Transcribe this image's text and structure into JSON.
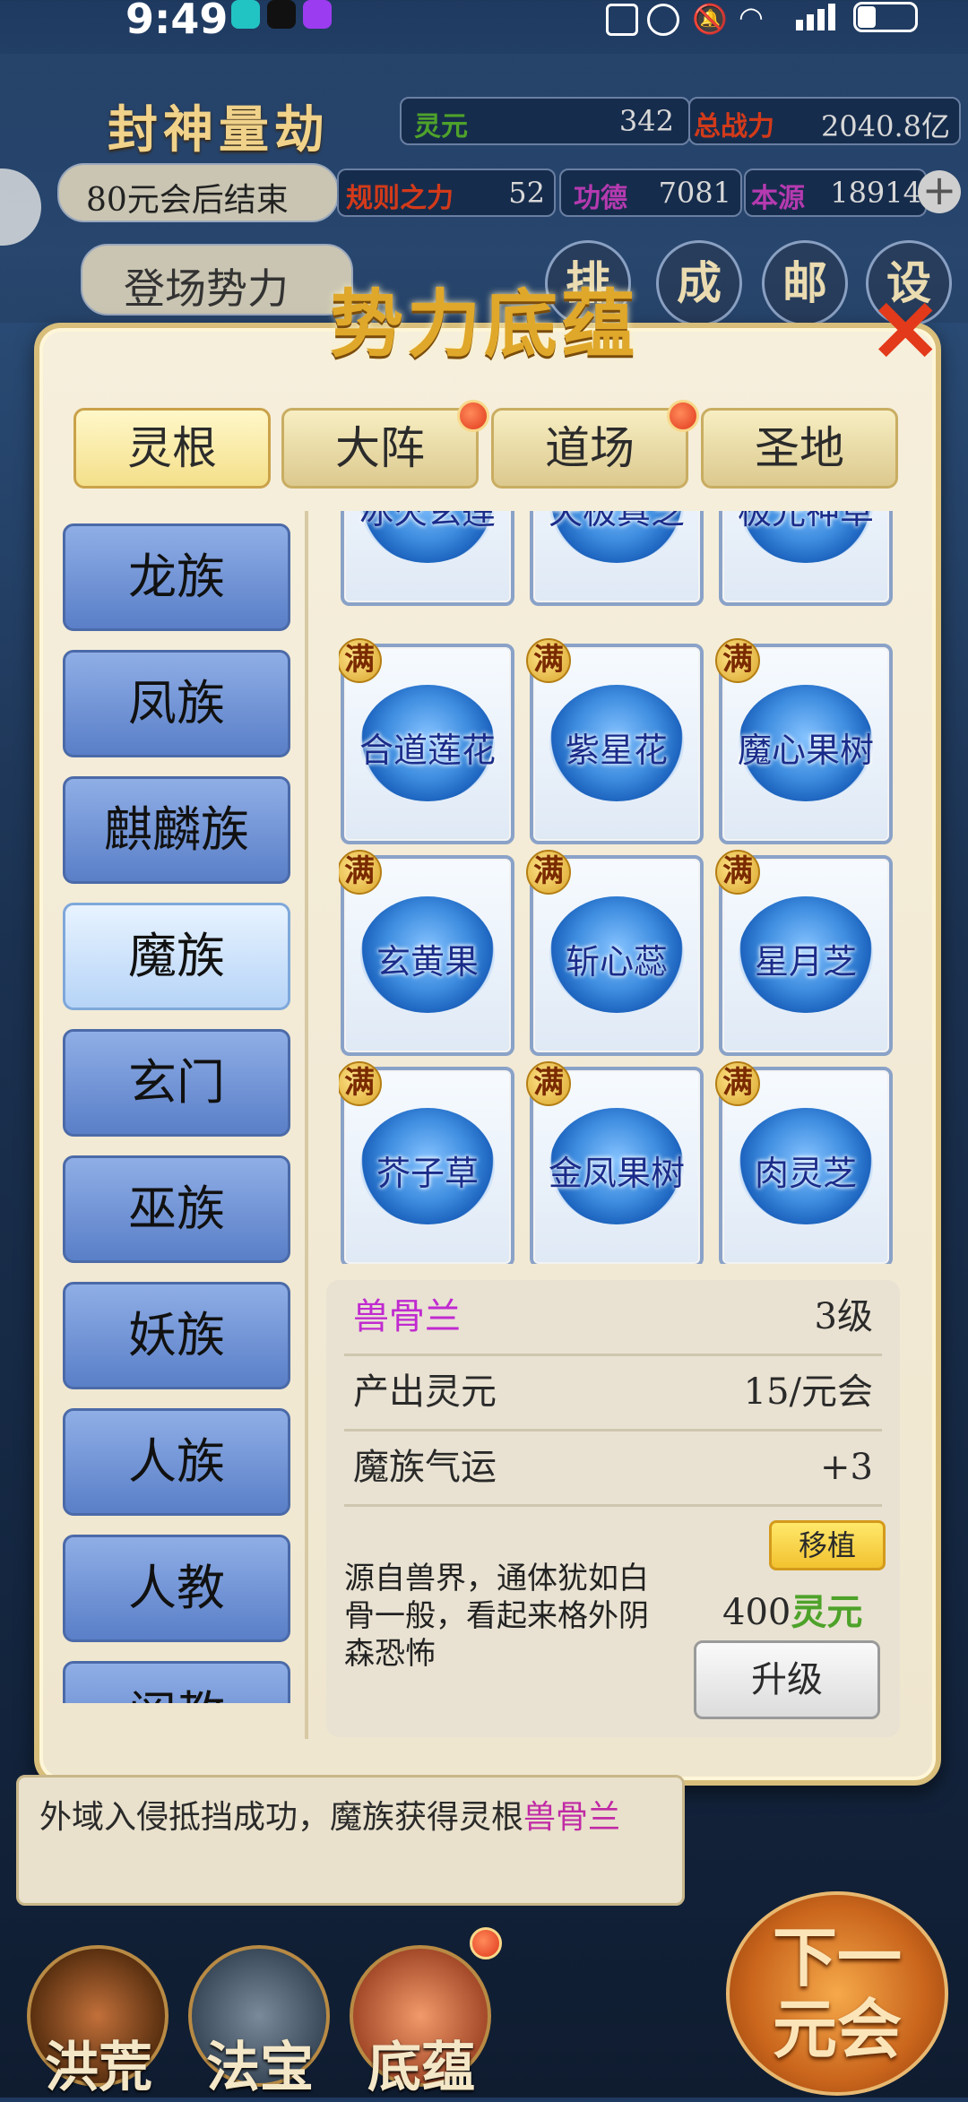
{
  "status_bar": {
    "time": "9:49",
    "app_icons": [
      "taptap-icon",
      "tiktok-icon",
      "purple-app-icon"
    ],
    "right_icons": [
      "nfc-icon",
      "alarm-icon",
      "mute-icon",
      "wifi-icon",
      "4g-signal-icon",
      "battery-icon"
    ]
  },
  "header": {
    "title": "封神量劫",
    "stats_row1": [
      {
        "label": "灵元",
        "value": "342",
        "label_color": "#4ea22a"
      },
      {
        "label": "总战力",
        "value": "2040.8亿",
        "label_color": "#d23a1a"
      }
    ],
    "countdown": "80元会后结束",
    "stats_row2": [
      {
        "label": "规则之力",
        "value": "52",
        "label_color": "#d23a1a"
      },
      {
        "label": "功德",
        "value": "7081",
        "label_color": "#b53ab0"
      },
      {
        "label": "本源",
        "value": "18914",
        "label_color": "#b53ab0"
      }
    ],
    "faction_button": "登场势力",
    "nav_buttons": [
      "排行",
      "成就",
      "邮件",
      "设置"
    ]
  },
  "modal": {
    "title": "势力底蕴",
    "tabs": [
      {
        "label": "灵根",
        "active": true,
        "dot": false
      },
      {
        "label": "大阵",
        "active": false,
        "dot": true
      },
      {
        "label": "道场",
        "active": false,
        "dot": true
      },
      {
        "label": "圣地",
        "active": false,
        "dot": false
      }
    ],
    "sidebar": [
      {
        "label": "龙族",
        "active": false
      },
      {
        "label": "凤族",
        "active": false
      },
      {
        "label": "麒麟族",
        "active": false
      },
      {
        "label": "魔族",
        "active": true
      },
      {
        "label": "玄门",
        "active": false
      },
      {
        "label": "巫族",
        "active": false
      },
      {
        "label": "妖族",
        "active": false
      },
      {
        "label": "人族",
        "active": false
      },
      {
        "label": "人教",
        "active": false
      },
      {
        "label": "阐教",
        "active": false
      }
    ],
    "grid_items": [
      {
        "name": "冰火玄莲",
        "badge": ""
      },
      {
        "name": "天极真芝",
        "badge": ""
      },
      {
        "name": "极光神草",
        "badge": ""
      },
      {
        "name": "合道莲花",
        "badge": "满"
      },
      {
        "name": "紫星花",
        "badge": "满"
      },
      {
        "name": "魔心果树",
        "badge": "满"
      },
      {
        "name": "玄黄果",
        "badge": "满"
      },
      {
        "name": "斩心蕊",
        "badge": "满"
      },
      {
        "name": "星月芝",
        "badge": "满"
      },
      {
        "name": "芥子草",
        "badge": "满"
      },
      {
        "name": "金凤果树",
        "badge": "满"
      },
      {
        "name": "肉灵芝",
        "badge": "满"
      }
    ],
    "detail": {
      "name": "兽骨兰",
      "name_color": "#c02ad0",
      "level": "3级",
      "rows": [
        {
          "label": "产出灵元",
          "value": "15/元会"
        },
        {
          "label": "魔族气运",
          "value": "+3"
        }
      ],
      "description": "源自兽界，通体犹如白骨一般，看起来格外阴森恐怖",
      "move_button": "移植",
      "cost_value": "400",
      "cost_unit": "灵元",
      "upgrade_button": "升级"
    }
  },
  "log": {
    "text": "外域入侵抵挡成功，魔族获得灵根",
    "highlight": "兽骨兰",
    "highlight_color": "#c02aa5"
  },
  "bottom_nav": [
    {
      "label": "洪荒",
      "icon": "lotus-icon",
      "dot": false
    },
    {
      "label": "法宝",
      "icon": "artifact-icon",
      "dot": false
    },
    {
      "label": "底蕴",
      "icon": "flame-lotus-icon",
      "dot": true
    }
  ],
  "next_button": "下一元会"
}
